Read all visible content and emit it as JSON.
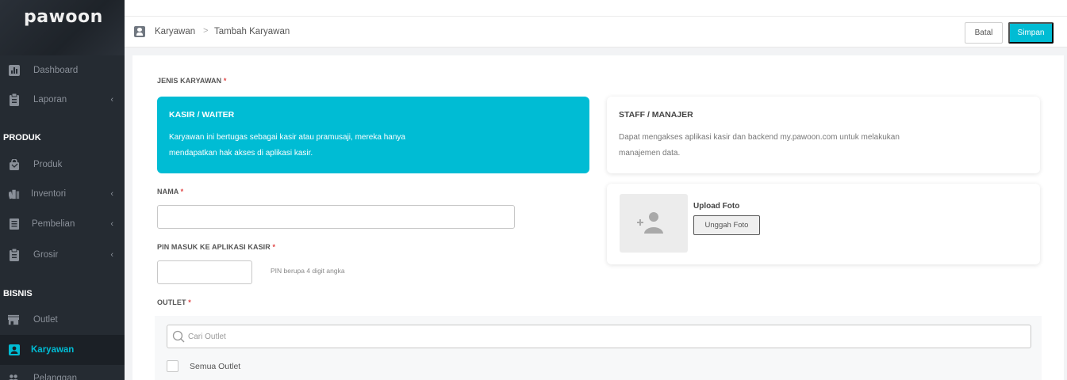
{
  "brand": {
    "logo_text": "pawoon"
  },
  "sidebar": {
    "items": [
      {
        "label": "Dashboard"
      },
      {
        "label": "Laporan"
      },
      {
        "label": "Produk"
      },
      {
        "label": "Inventori"
      },
      {
        "label": "Pembelian"
      },
      {
        "label": "Grosir"
      },
      {
        "label": "Outlet"
      },
      {
        "label": "Karyawan"
      },
      {
        "label": "Pelanggan"
      }
    ],
    "sections": {
      "produk": "PRODUK",
      "bisnis": "BISNIS"
    },
    "chevron": "‹"
  },
  "header": {
    "breadcrumb": [
      "Karyawan",
      "Tambah Karyawan"
    ],
    "breadcrumb_sep": ">",
    "batal_label": "Batal",
    "simpan_label": "Simpan"
  },
  "form": {
    "jenis_label": "JENIS KARYAWAN",
    "required_mark": "*",
    "kasir": {
      "title": "KASIR / WAITER",
      "description": "Karyawan ini bertugas sebagai kasir atau pramusaji, mereka hanya mendapatkan hak akses di aplikasi kasir."
    },
    "staff": {
      "title": "STAFF / MANAJER",
      "description": "Dapat mengakses aplikasi kasir dan backend my.pawoon.com untuk melakukan manajemen data."
    },
    "nama_label": "NAMA",
    "nama_value": "",
    "pin_label": "PIN MASUK KE APLIKASI KASIR",
    "pin_value": "",
    "pin_hint": "PIN berupa 4 digit angka",
    "outlet_label": "OUTLET",
    "upload_title": "Upload Foto",
    "upload_button": "Unggah Foto",
    "search_placeholder": "Cari Outlet",
    "semua_outlet": "Semua Outlet"
  },
  "colors": {
    "accent": "#00bcd4",
    "sidebar_bg": "#252b32",
    "required": "#e04343"
  }
}
